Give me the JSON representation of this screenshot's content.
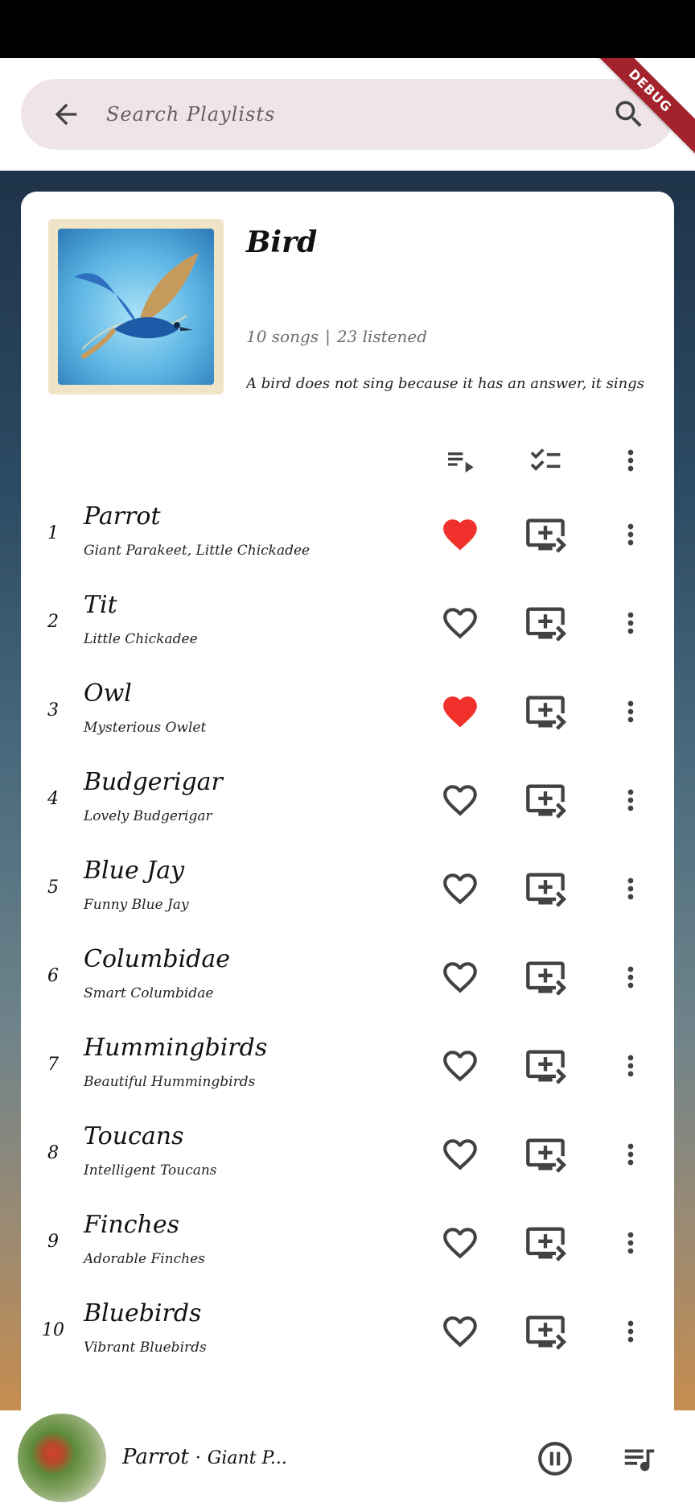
{
  "colors": {
    "accent_heart": "#f0302b",
    "icon_gray": "#424242",
    "search_bg": "#efe5e9",
    "debug_ribbon": "#a3222b"
  },
  "search": {
    "placeholder": "Search Playlists",
    "back_icon": "arrow-back-icon",
    "search_icon": "search-icon"
  },
  "debug_banner": "DEBUG",
  "playlist": {
    "title": "Bird",
    "song_count": "10 songs",
    "separator": "|",
    "listened": "23 listened",
    "description": "A bird does not sing because it has an answer, it sings",
    "toolbar_icons": [
      "playlist-play-icon",
      "checklist-icon",
      "more-vert-icon"
    ]
  },
  "songs": [
    {
      "index": "1",
      "title": "Parrot",
      "artist": "Giant Parakeet, Little Chickadee",
      "favorite": true
    },
    {
      "index": "2",
      "title": "Tit",
      "artist": "Little Chickadee",
      "favorite": false
    },
    {
      "index": "3",
      "title": "Owl",
      "artist": "Mysterious Owlet",
      "favorite": true
    },
    {
      "index": "4",
      "title": "Budgerigar",
      "artist": "Lovely Budgerigar",
      "favorite": false
    },
    {
      "index": "5",
      "title": "Blue Jay",
      "artist": "Funny Blue Jay",
      "favorite": false
    },
    {
      "index": "6",
      "title": "Columbidae",
      "artist": "Smart Columbidae",
      "favorite": false
    },
    {
      "index": "7",
      "title": "Hummingbirds",
      "artist": "Beautiful Hummingbirds",
      "favorite": false
    },
    {
      "index": "8",
      "title": "Toucans",
      "artist": "Intelligent Toucans",
      "favorite": false
    },
    {
      "index": "9",
      "title": "Finches",
      "artist": "Adorable Finches",
      "favorite": false
    },
    {
      "index": "10",
      "title": "Bluebirds",
      "artist": "Vibrant Bluebirds",
      "favorite": false
    }
  ],
  "now_playing": {
    "title": "Parrot",
    "separator": "·",
    "artist": "Giant P...",
    "pause_icon": "pause-circle-icon",
    "queue_icon": "queue-music-icon"
  }
}
